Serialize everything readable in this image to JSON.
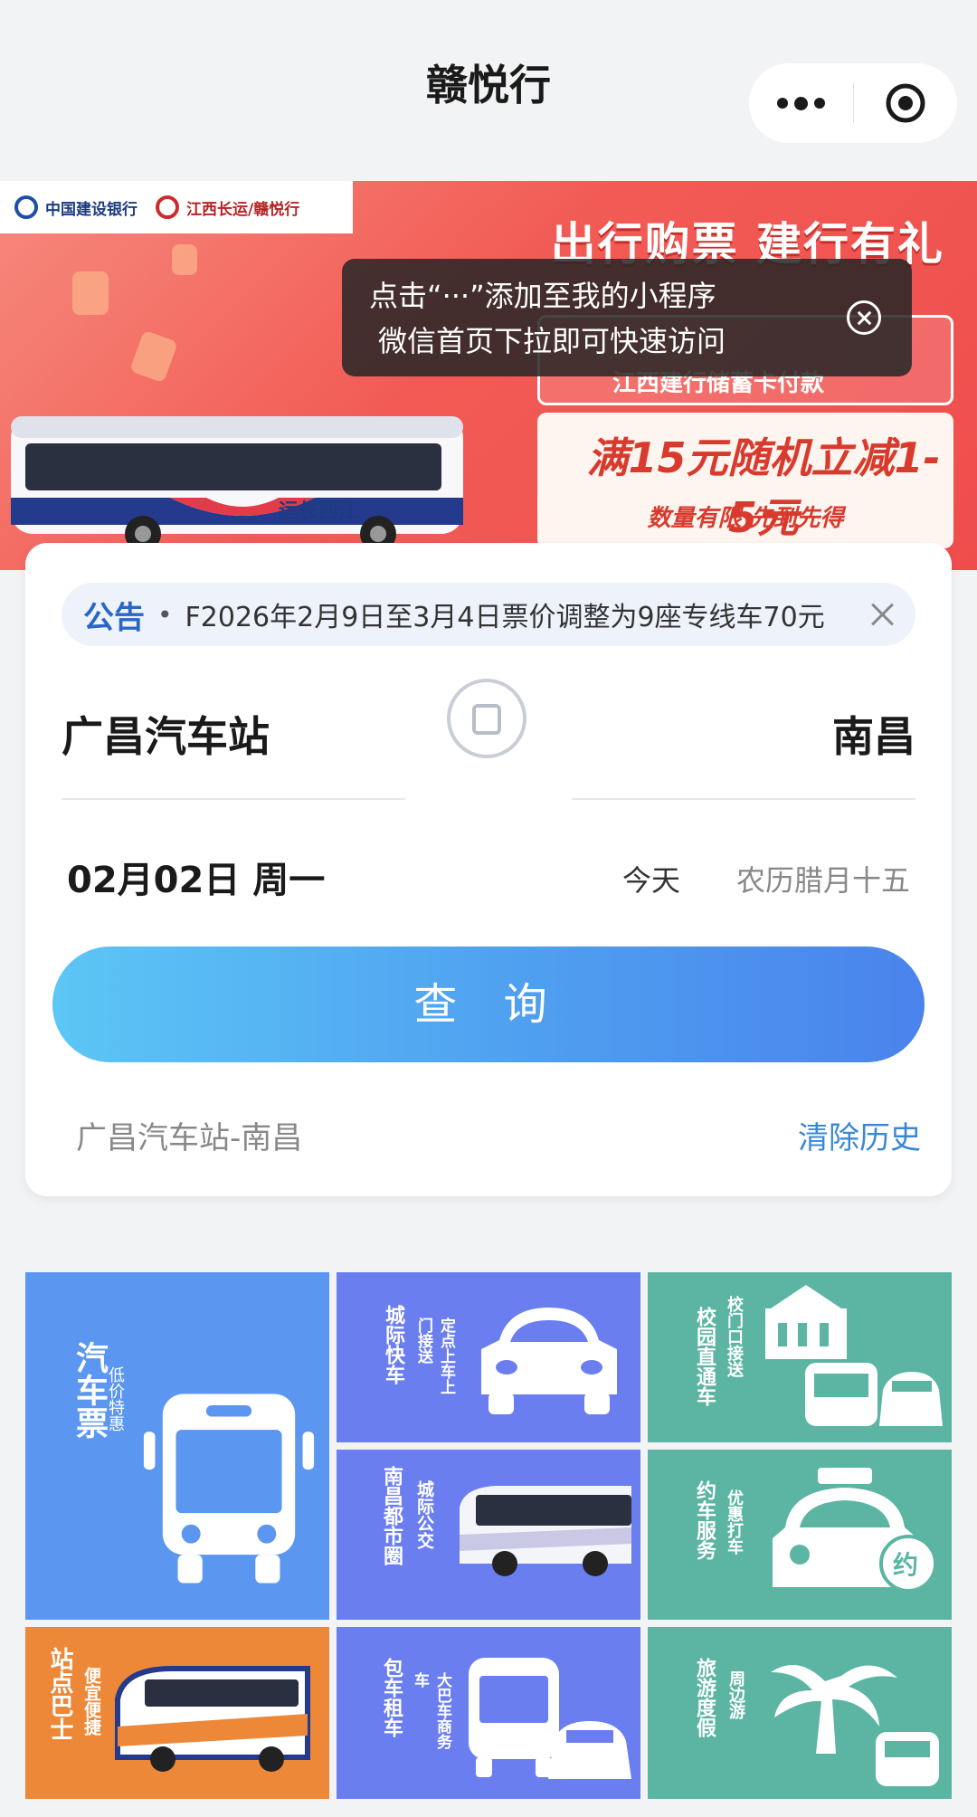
{
  "app": {
    "title": "赣悦行"
  },
  "banner": {
    "bank_name": "中国建设银行",
    "partner_name": "江西长运/赣悦行",
    "promo_title": "出行购票 建行有礼",
    "promo_line": "江西建行储蓄卡付款",
    "promo_offer": "满15元随机立减1-5元",
    "promo_note": "数量有限 先到先得",
    "bus_livery": "运长西江"
  },
  "tooltip": {
    "line1": "点击“···”添加至我的小程序",
    "line2": "微信首页下拉即可快速访问"
  },
  "notice": {
    "tag": "公告",
    "text": "F2026年2月9日至3月4日票价调整为9座专线车70元"
  },
  "route": {
    "from": "广昌汽车站",
    "to": "南昌",
    "date": "02月02日 周一",
    "today_label": "今天",
    "lunar": "农历腊月十五"
  },
  "search_button": "查 询",
  "history": {
    "item": "广昌汽车站-南昌",
    "clear_label": "清除历史"
  },
  "services": [
    {
      "title": "汽车票",
      "sub": "低价特惠",
      "icon": "bus-front-icon",
      "color": "#5b96f0"
    },
    {
      "title": "城际快车",
      "sub": "定点上车上门接送",
      "icon": "car-front-icon",
      "color": "#6a7ef0"
    },
    {
      "title": "校园直通车",
      "sub": "校门口接送",
      "icon": "school-bus-icon",
      "color": "#5bb5a2"
    },
    {
      "title": "南昌都市圈",
      "sub": "城际公交",
      "icon": "coach-bus-icon",
      "color": "#6a7ef0"
    },
    {
      "title": "约车服务",
      "sub": "优惠打车",
      "icon": "taxi-icon",
      "color": "#5bb5a2"
    },
    {
      "title": "站点巴士",
      "sub": "便宜便捷",
      "icon": "station-bus-icon",
      "color": "#ec8838"
    },
    {
      "title": "包车租车",
      "sub": "大巴车商务车",
      "icon": "charter-bus-icon",
      "color": "#6a7ef0"
    },
    {
      "title": "旅游度假",
      "sub": "周边游",
      "icon": "palm-tree-icon",
      "color": "#5bb5a2"
    }
  ]
}
